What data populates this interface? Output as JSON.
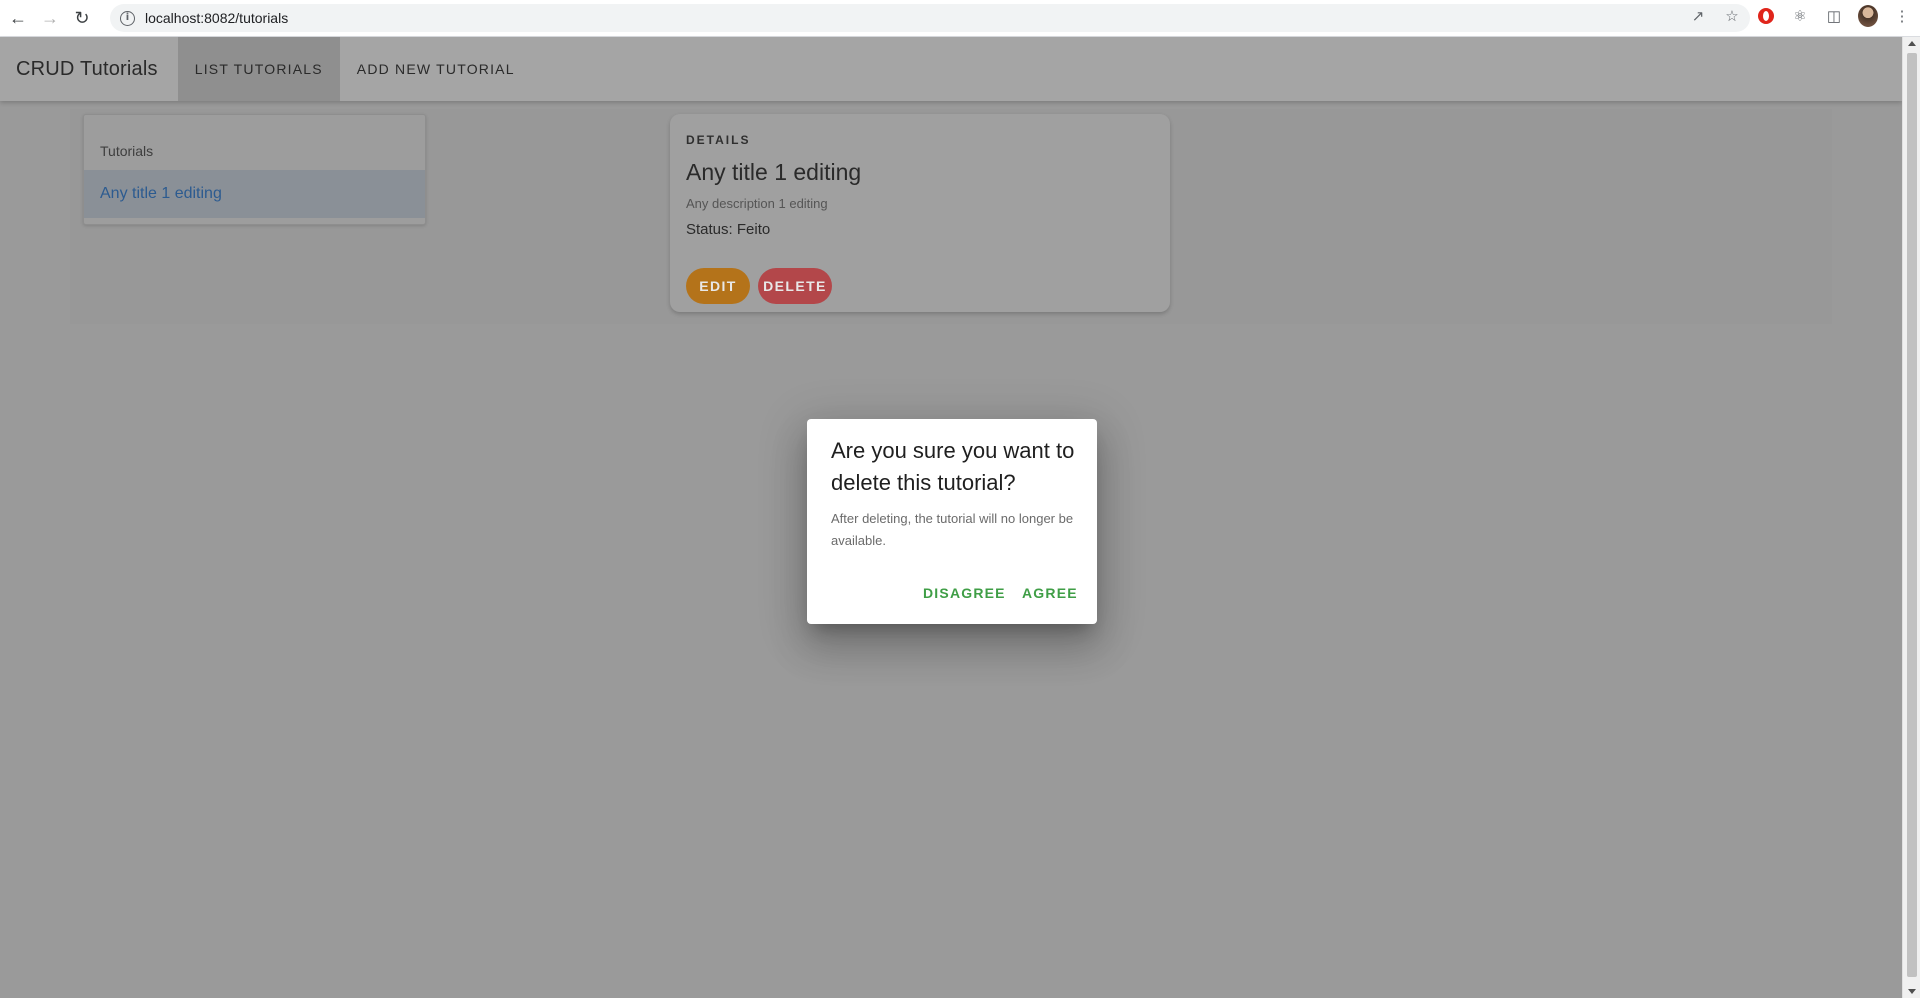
{
  "browser": {
    "url": "localhost:8082/tutorials",
    "icons": [
      "back-arrow-icon",
      "forward-arrow-icon",
      "reload-icon",
      "info-icon",
      "share-icon",
      "star-icon",
      "opera-icon",
      "extensions-icon",
      "sidepanel-icon",
      "avatar",
      "menu-dots-icon"
    ]
  },
  "appbar": {
    "title": "CRUD Tutorials",
    "tabs": [
      {
        "label": "LIST TUTORIALS",
        "active": true
      },
      {
        "label": "ADD NEW TUTORIAL",
        "active": false
      }
    ]
  },
  "list": {
    "subheader": "Tutorials",
    "items": [
      {
        "label": "Any title 1 editing",
        "selected": true
      }
    ]
  },
  "details": {
    "overline": "DETAILS",
    "title": "Any title 1 editing",
    "description": "Any description 1 editing",
    "status": "Status: Feito",
    "edit_label": "EDIT",
    "delete_label": "DELETE"
  },
  "dialog": {
    "title": "Are you sure you want to delete this tutorial?",
    "text": "After deleting, the tutorial will no longer be available.",
    "disagree_label": "DISAGREE",
    "agree_label": "AGREE"
  },
  "colors": {
    "accent_green": "#3f9e46",
    "edit_orange": "#b4731a",
    "delete_red": "#b3474a",
    "link_blue": "#2c5b90"
  }
}
